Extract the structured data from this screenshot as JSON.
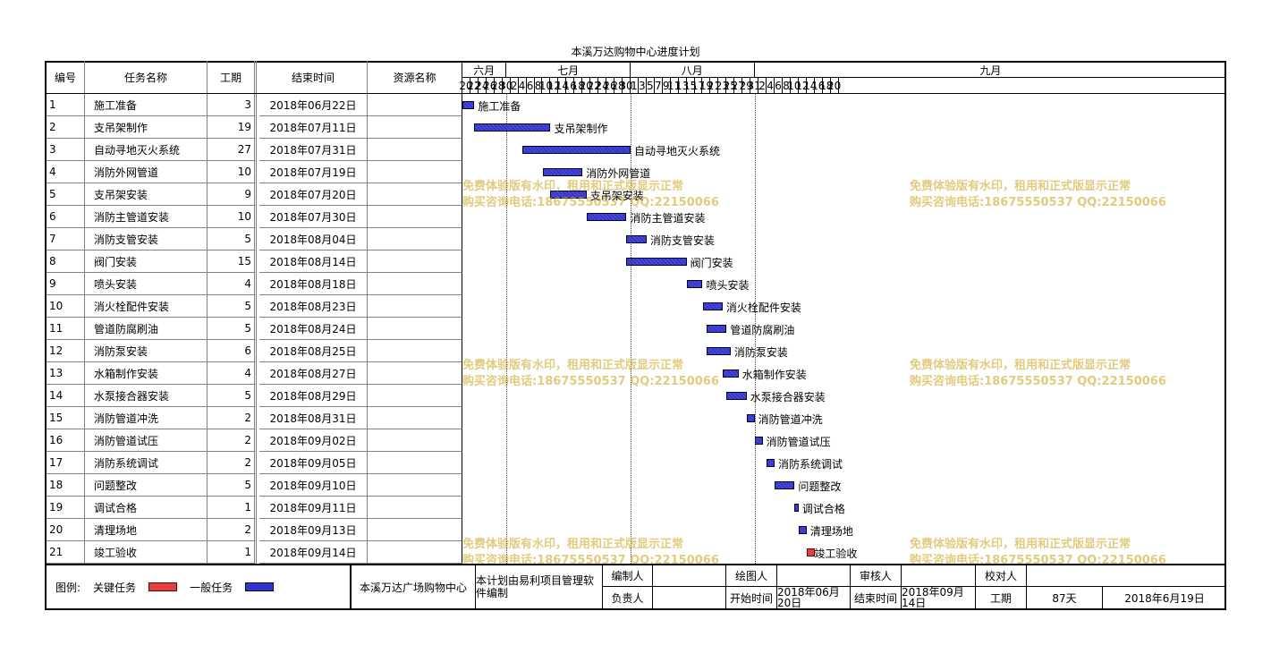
{
  "title": "本溪万达购物中心进度计划",
  "columns": {
    "num": "编号",
    "name": "任务名称",
    "dur": "工期",
    "end": "结束时间",
    "res": "资源名称"
  },
  "months": [
    "六月",
    "七月",
    "八月",
    "九月"
  ],
  "days": [
    "20",
    "22",
    "24",
    "26",
    "28",
    "30",
    "2",
    "4",
    "6",
    "8",
    "10",
    "12",
    "14",
    "16",
    "18",
    "20",
    "22",
    "24",
    "26",
    "28",
    "30",
    "1",
    "3",
    "5",
    "7",
    "9",
    "11",
    "13",
    "15",
    "17",
    "19",
    "21",
    "23",
    "25",
    "27",
    "29",
    "31",
    "2",
    "4",
    "6",
    "8",
    "10",
    "12",
    "14",
    "16",
    "18",
    "20"
  ],
  "tasks": [
    {
      "num": "1",
      "name": "施工准备",
      "dur": "3",
      "end": "2018年06月22日",
      "label": "施工准备"
    },
    {
      "num": "2",
      "name": "支吊架制作",
      "dur": "19",
      "end": "2018年07月11日",
      "label": "支吊架制作"
    },
    {
      "num": "3",
      "name": "自动寻地灭火系统",
      "dur": "27",
      "end": "2018年07月31日",
      "label": "自动寻地灭火系统"
    },
    {
      "num": "4",
      "name": "消防外网管道",
      "dur": "10",
      "end": "2018年07月19日",
      "label": "消防外网管道"
    },
    {
      "num": "5",
      "name": "支吊架安装",
      "dur": "9",
      "end": "2018年07月20日",
      "label": "支吊架安装"
    },
    {
      "num": "6",
      "name": "消防主管道安装",
      "dur": "10",
      "end": "2018年07月30日",
      "label": "消防主管道安装"
    },
    {
      "num": "7",
      "name": "消防支管安装",
      "dur": "5",
      "end": "2018年08月04日",
      "label": "消防支管安装"
    },
    {
      "num": "8",
      "name": "阀门安装",
      "dur": "15",
      "end": "2018年08月14日",
      "label": "阀门安装"
    },
    {
      "num": "9",
      "name": "喷头安装",
      "dur": "4",
      "end": "2018年08月18日",
      "label": "喷头安装"
    },
    {
      "num": "10",
      "name": "消火栓配件安装",
      "dur": "5",
      "end": "2018年08月23日",
      "label": "消火栓配件安装"
    },
    {
      "num": "11",
      "name": "管道防腐刷油",
      "dur": "5",
      "end": "2018年08月24日",
      "label": "管道防腐刷油"
    },
    {
      "num": "12",
      "name": "消防泵安装",
      "dur": "6",
      "end": "2018年08月25日",
      "label": "消防泵安装"
    },
    {
      "num": "13",
      "name": "水箱制作安装",
      "dur": "4",
      "end": "2018年08月27日",
      "label": "水箱制作安装"
    },
    {
      "num": "14",
      "name": "水泵接合器安装",
      "dur": "5",
      "end": "2018年08月29日",
      "label": "水泵接合器安装"
    },
    {
      "num": "15",
      "name": "消防管道冲洗",
      "dur": "2",
      "end": "2018年08月31日",
      "label": "消防管道冲洗"
    },
    {
      "num": "16",
      "name": "消防管道试压",
      "dur": "2",
      "end": "2018年09月02日",
      "label": "消防管道试压"
    },
    {
      "num": "17",
      "name": "消防系统调试",
      "dur": "2",
      "end": "2018年09月05日",
      "label": "消防系统调试"
    },
    {
      "num": "18",
      "name": "问题整改",
      "dur": "5",
      "end": "2018年09月10日",
      "label": "问题整改"
    },
    {
      "num": "19",
      "name": "调试合格",
      "dur": "1",
      "end": "2018年09月11日",
      "label": "调试合格"
    },
    {
      "num": "20",
      "name": "清理场地",
      "dur": "2",
      "end": "2018年09月13日",
      "label": "清理场地"
    },
    {
      "num": "21",
      "name": "竣工验收",
      "dur": "1",
      "end": "2018年09月14日",
      "label": "竣工验收"
    }
  ],
  "watermark": {
    "line1": "免费体验版有水印，租用和正式版显示正常",
    "line2": "购买咨询电话:18675550537 QQ:22150066"
  },
  "footer": {
    "legend_label": "图例:",
    "critical_label": "关键任务",
    "normal_label": "一般任务",
    "project_name": "本溪万达广场购物中心",
    "software_note": "本计划由易利项目管理软件编制",
    "editor_label": "编制人",
    "drawer_label": "绘图人",
    "reviewer_label": "审核人",
    "checker_label": "校对人",
    "owner_label": "负责人",
    "start_label": "开始时间",
    "start_value": "2018年06月20日",
    "end_label": "结束时间",
    "end_value": "2018年09月14日",
    "duration_label": "工期",
    "duration_value": "87天",
    "date_value": "2018年6月19日"
  },
  "colors": {
    "normal_bar": "#3333cc",
    "critical_bar": "#e04040",
    "watermark": "#c8a014"
  }
}
